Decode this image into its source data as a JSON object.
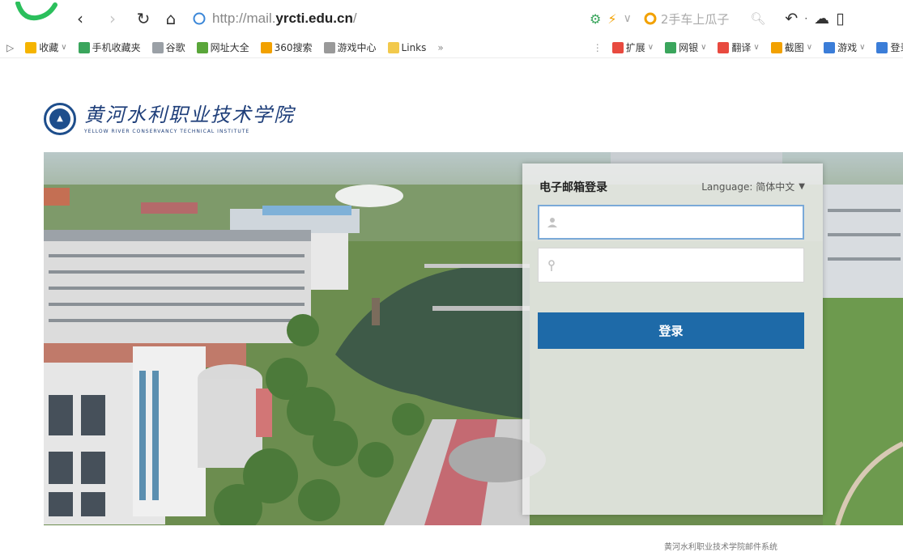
{
  "browser": {
    "url_prefix": "http://mail.",
    "url_domain": "yrcti.edu.cn",
    "url_suffix": "/",
    "search_hot_text": "2手车上瓜子",
    "bookmarks": [
      {
        "label": "收藏",
        "icon": "star-icon",
        "color": "#f5b400",
        "dropdown": true
      },
      {
        "label": "手机收藏夹",
        "icon": "phone-icon",
        "color": "#3aa55c",
        "dropdown": false
      },
      {
        "label": "谷歌",
        "icon": "page-icon",
        "color": "#9aa0a6",
        "dropdown": false
      },
      {
        "label": "网址大全",
        "icon": "globe-icon",
        "color": "#5aa63a",
        "dropdown": false
      },
      {
        "label": "360搜索",
        "icon": "search360-icon",
        "color": "#f2a100",
        "dropdown": false
      },
      {
        "label": "游戏中心",
        "icon": "game-icon",
        "color": "#999999",
        "dropdown": false
      },
      {
        "label": "Links",
        "icon": "folder-icon",
        "color": "#f2c94c",
        "dropdown": false
      }
    ],
    "more_label": "»",
    "right_bookmarks": [
      {
        "label": "扩展",
        "icon": "extension-icon",
        "color": "#e84a3f"
      },
      {
        "label": "网银",
        "icon": "bank-icon",
        "color": "#3aa55c"
      },
      {
        "label": "翻译",
        "icon": "translate-icon",
        "color": "#e84a3f"
      },
      {
        "label": "截图",
        "icon": "screenshot-icon",
        "color": "#f2a100"
      },
      {
        "label": "游戏",
        "icon": "gamepad-icon",
        "color": "#3b7dd8"
      },
      {
        "label": "登录",
        "icon": "login-icon",
        "color": "#3b7dd8"
      }
    ]
  },
  "school": {
    "name_cn": "黄河水利职业技术学院",
    "name_en": "YELLOW RIVER CONSERVANCY TECHNICAL INSTITUTE"
  },
  "login": {
    "title": "电子邮箱登录",
    "language_label": "Language:",
    "language_value": "简体中文",
    "username_placeholder": "",
    "password_placeholder": "",
    "button_label": "登录"
  },
  "footer": {
    "text": "黄河水利职业技术学院邮件系统"
  },
  "colors": {
    "primary_button": "#1e6aa8",
    "school_blue": "#1f3f7a"
  }
}
